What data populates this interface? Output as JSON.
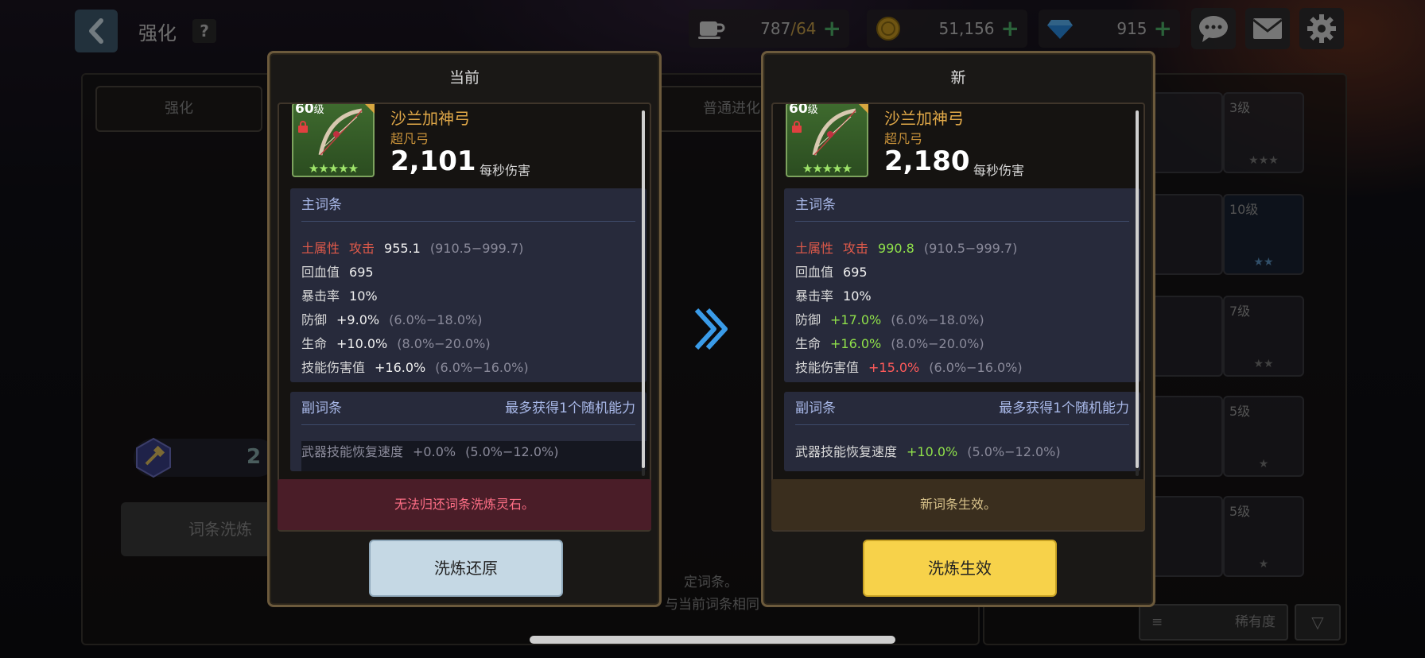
{
  "header": {
    "title": "强化",
    "help": "?"
  },
  "resources": {
    "stamina": {
      "value": "787",
      "cap": "/64",
      "icon": "coffee-icon"
    },
    "gold": {
      "value": "51,156",
      "icon": "coin-icon"
    },
    "gems": {
      "value": "915",
      "icon": "gem-icon"
    }
  },
  "background": {
    "tabs": [
      "强化",
      "普通进化"
    ],
    "reroll_label": "词条洗炼",
    "count_text": "2",
    "note_1": "定词条。",
    "note_2": "与当前词条相同",
    "rarity_label": "稀有度",
    "slots": [
      {
        "level": "3级",
        "stars": "★★★"
      },
      {
        "level": "10级",
        "stars": "★★"
      },
      {
        "level": "7级",
        "stars": "★★"
      },
      {
        "level": "5级",
        "stars": "★"
      },
      {
        "level": "5级",
        "stars": "★"
      }
    ]
  },
  "current": {
    "title": "当前",
    "level": "60",
    "level_unit": "级",
    "stars": "★★★★★",
    "name": "沙兰加神弓",
    "rarity": "超凡弓",
    "dps": "2,101",
    "dps_label": "每秒伤害",
    "main_header": "主词条",
    "main": [
      {
        "k1": "土属性",
        "k2": "攻击",
        "v": "955.1",
        "range": "(910.5−999.7)"
      },
      {
        "k": "回血值",
        "v": "695"
      },
      {
        "k": "暴击率",
        "v": "10%"
      },
      {
        "k": "防御",
        "v": "+9.0%",
        "range": "(6.0%−18.0%)"
      },
      {
        "k": "生命",
        "v": "+10.0%",
        "range": "(8.0%−20.0%)"
      },
      {
        "k": "技能伤害值",
        "v": "+16.0%",
        "range": "(6.0%−16.0%)"
      }
    ],
    "sub_header": "副词条",
    "sub_note": "最多获得1个随机能力",
    "sub": {
      "k": "武器技能恢复速度",
      "v": "+0.0%",
      "range": "(5.0%−12.0%)"
    },
    "notice": "无法归还词条洗炼灵石。",
    "button": "洗炼还原"
  },
  "new": {
    "title": "新",
    "level": "60",
    "level_unit": "级",
    "stars": "★★★★★",
    "name": "沙兰加神弓",
    "rarity": "超凡弓",
    "dps": "2,180",
    "dps_label": "每秒伤害",
    "main_header": "主词条",
    "main": [
      {
        "k1": "土属性",
        "k2": "攻击",
        "v": "990.8",
        "range": "(910.5−999.7)"
      },
      {
        "k": "回血值",
        "v": "695"
      },
      {
        "k": "暴击率",
        "v": "10%"
      },
      {
        "k": "防御",
        "v": "+17.0%",
        "range": "(6.0%−18.0%)"
      },
      {
        "k": "生命",
        "v": "+16.0%",
        "range": "(8.0%−20.0%)"
      },
      {
        "k": "技能伤害值",
        "v": "+15.0%",
        "range": "(6.0%−16.0%)"
      }
    ],
    "sub_header": "副词条",
    "sub_note": "最多获得1个随机能力",
    "sub": {
      "k": "武器技能恢复速度",
      "v": "+10.0%",
      "range": "(5.0%−12.0%)"
    },
    "notice": "新词条生效。",
    "button": "洗炼生效"
  },
  "colors": {
    "increase": "#8fe04a",
    "decrease": "#ff5a5a",
    "element": "#e05a4a",
    "confirm": "#f7d24a",
    "revert": "#c5d8e4"
  }
}
